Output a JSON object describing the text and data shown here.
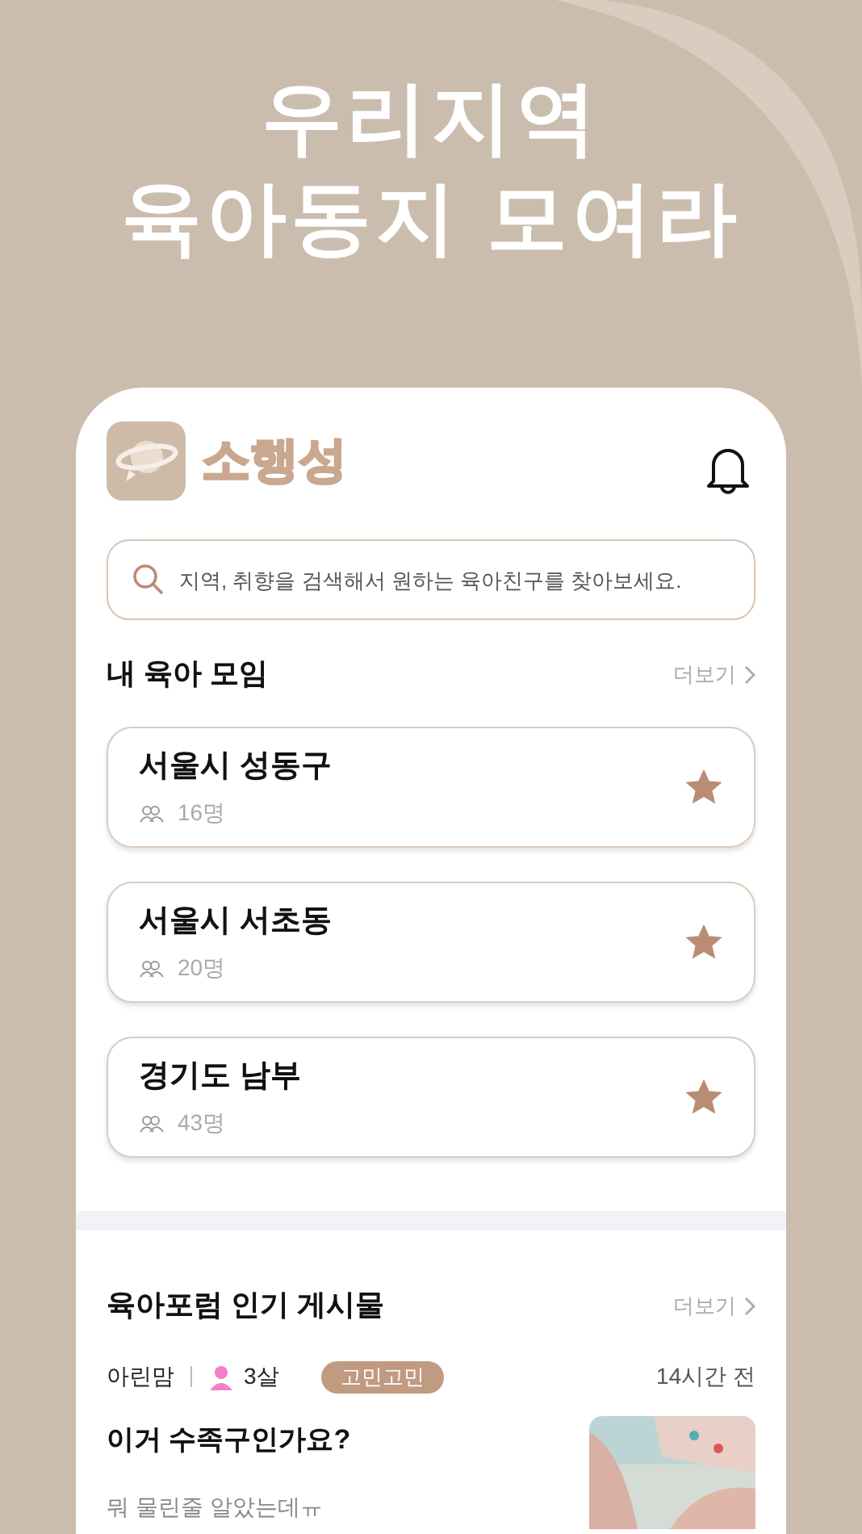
{
  "headline": [
    "우리지역",
    "육아동지 모여라"
  ],
  "app": {
    "logo_text": "소행성"
  },
  "search": {
    "placeholder": "지역, 취향을 검색해서 원하는 육아친구를 찾아보세요."
  },
  "my_groups": {
    "title": "내 육아 모임",
    "more": "더보기",
    "items": [
      {
        "name": "서울시 성동구",
        "members": "16명",
        "starred": true
      },
      {
        "name": "서울시 서초동",
        "members": "20명",
        "starred": true
      },
      {
        "name": "경기도 남부",
        "members": "43명",
        "starred": true
      }
    ]
  },
  "forum": {
    "title": "육아포럼 인기 게시물",
    "more": "더보기",
    "post": {
      "author": "아린맘",
      "child_age": "3살",
      "tag": "고민고민",
      "time": "14시간 전",
      "title": "이거 수족구인가요?",
      "body": "뭐 물린줄 알았는데ㅠ"
    }
  }
}
